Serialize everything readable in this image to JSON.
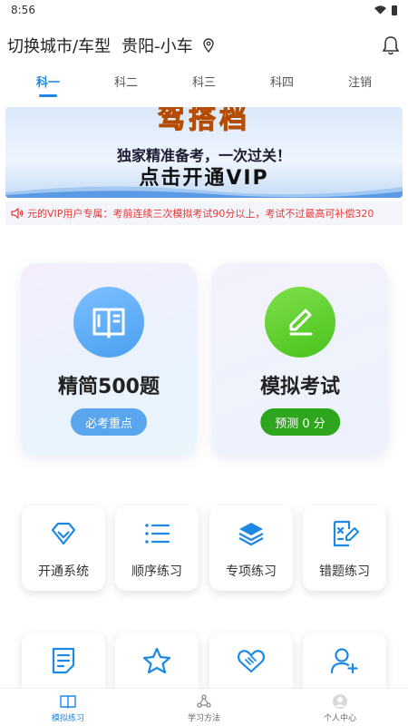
{
  "status": {
    "time": "8:56"
  },
  "header": {
    "title": "切换城市/车型",
    "location": "贵阳-小车"
  },
  "tabs": [
    {
      "label": "科一",
      "active": true
    },
    {
      "label": "科二",
      "active": false
    },
    {
      "label": "科三",
      "active": false
    },
    {
      "label": "科四",
      "active": false
    },
    {
      "label": "注销",
      "active": false
    }
  ],
  "banner": {
    "brand": "驾搭档",
    "line1": "独家精准备考，一次过关！",
    "line2": "点击开通VIP"
  },
  "notice": {
    "text": "元的VIP用户专属：考前连续三次模拟考试90分以上，考试不过最高可补偿320"
  },
  "big_cards": [
    {
      "title": "精简500题",
      "pill": "必考重点",
      "icon": "book-icon"
    },
    {
      "title": "模拟考试",
      "pill": "预测 0 分",
      "icon": "pen-icon"
    }
  ],
  "small_cards_row1": [
    {
      "label": "开通系统",
      "icon": "diamond-icon"
    },
    {
      "label": "顺序练习",
      "icon": "list-icon"
    },
    {
      "label": "专项练习",
      "icon": "layers-icon"
    },
    {
      "label": "错题练习",
      "icon": "error-doc-icon"
    }
  ],
  "small_cards_row2": [
    {
      "label": "",
      "icon": "note-icon"
    },
    {
      "label": "",
      "icon": "star-icon"
    },
    {
      "label": "",
      "icon": "handshake-icon"
    },
    {
      "label": "",
      "icon": "add-user-icon"
    }
  ],
  "bottom_nav": [
    {
      "label": "模拟练习",
      "icon": "book-open-icon",
      "active": true
    },
    {
      "label": "学习方法",
      "icon": "share-icon",
      "active": false
    },
    {
      "label": "个人中心",
      "icon": "person-icon",
      "active": false
    }
  ],
  "colors": {
    "accent": "#1e88e5",
    "notice_red": "#e53935",
    "green": "#2da51d",
    "blue_pill": "#5aa6ee"
  }
}
